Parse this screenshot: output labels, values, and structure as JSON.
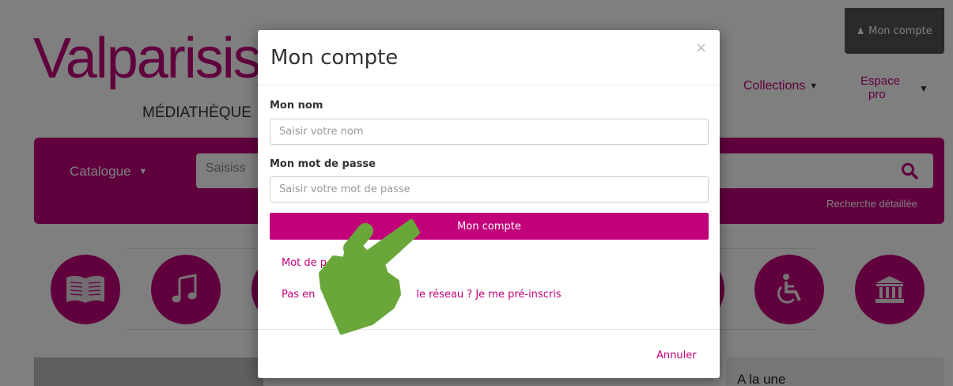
{
  "site": {
    "logo_text": "Valparisis",
    "logo_subtitle": "MÉDIATHÈQUE",
    "account_button": "Mon compte",
    "nav_collections": "Collections",
    "nav_pro_line1": "Espace",
    "nav_pro_line2": "pro",
    "catalogue_label": "Catalogue",
    "search_placeholder": "Saisiss",
    "advanced_search": "Recherche détaillée",
    "a_la_une": "A la une",
    "brand_color": "#c1007a",
    "category_icons": [
      "book-icon",
      "music-icon",
      "accessibility-icon",
      "institution-icon"
    ]
  },
  "modal": {
    "title": "Mon compte",
    "close_glyph": "×",
    "name_label": "Mon nom",
    "name_placeholder": "Saisir votre nom",
    "name_value": "",
    "password_label": "Mon mot de passe",
    "password_placeholder": "Saisir votre mot de passe",
    "password_value": "",
    "submit_label": "Mon compte",
    "forgot_link": "Mot de p",
    "register_link_start": "Pas en",
    "register_link_end": "le réseau ? Je me pré-inscris",
    "cancel_label": "Annuler"
  },
  "hand_color": "#6aa73a"
}
